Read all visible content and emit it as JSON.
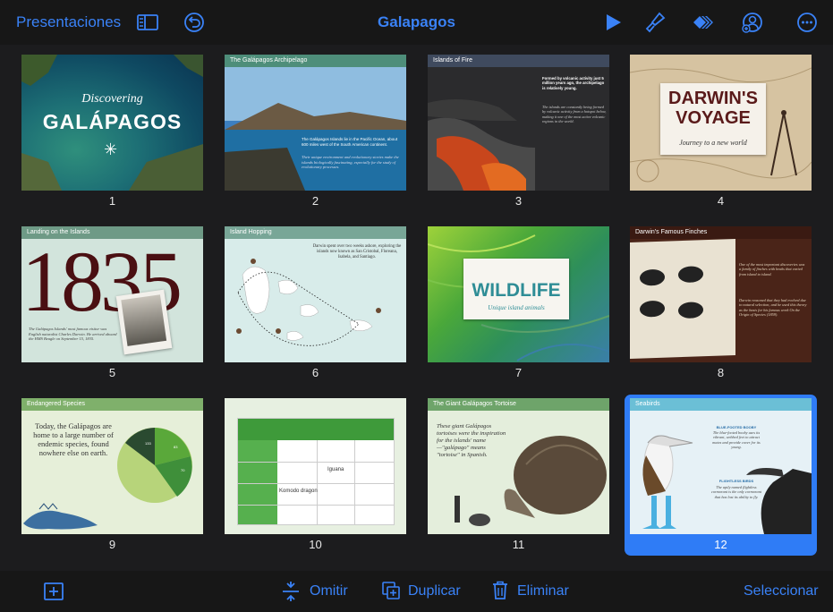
{
  "topbar": {
    "back_label": "Presentaciones",
    "title": "Galapagos"
  },
  "icons": {
    "sidebar": "sidebar-icon",
    "undo": "undo-icon",
    "play": "play-icon",
    "format": "paintbrush-icon",
    "animate": "animate-icon",
    "collaborate": "collaborate-icon",
    "more": "more-icon"
  },
  "slides": [
    {
      "number": "1",
      "title": "Discovering",
      "subtitle": "GALÁPAGOS"
    },
    {
      "number": "2",
      "title": "The Galápagos Archipelago",
      "bullet1": "The Galápagos Islands lie in the Pacific Ocean, about 600 miles west of the South American continent.",
      "bullet2": "Their unique environment and evolutionary stories make the islands biologically fascinating, especially for the study of evolutionary processes."
    },
    {
      "number": "3",
      "title": "Islands of Fire",
      "text1": "Formed by volcanic activity just 5 million years ago, the archipelago is relatively young.",
      "text2": "The islands are constantly being formed by volcanic activity from a hotspot below, making it one of the most active volcanic regions in the world."
    },
    {
      "number": "4",
      "title": "DARWIN'S VOYAGE",
      "subtitle": "Journey to a new world"
    },
    {
      "number": "5",
      "title": "Landing on the Islands",
      "year": "1835",
      "caption": "The Galápagos Islands' most famous visitor was English naturalist Charles Darwin. He arrived aboard the HMS Beagle on September 15, 1835."
    },
    {
      "number": "6",
      "title": "Island Hopping",
      "text": "Darwin spent over two weeks ashore, exploring the islands now known as San Cristobal, Floreana, Isabela, and Santiago."
    },
    {
      "number": "7",
      "title": "WILDLIFE",
      "subtitle": "Unique island animals"
    },
    {
      "number": "8",
      "title": "Darwin's Famous Finches",
      "text1": "One of the most important discoveries was a family of finches with beaks that varied from island to island.",
      "text2": "Darwin reasoned that they had evolved due to natural selection, and he used this theory as the basis for his famous work On the Origin of Species (1859)."
    },
    {
      "number": "9",
      "title": "Endangered Species",
      "text": "Today, the Galápagos are home to a large number of endemic species, found nowhere else on earth.",
      "chart_values": [
        "133",
        "83",
        "70"
      ]
    },
    {
      "number": "10",
      "table_label1": "Iguana",
      "table_label2": "Komodo dragon"
    },
    {
      "number": "11",
      "title": "The Giant Galápagos Tortoise",
      "text": "These giant Galápagos tortoises were the inspiration for the islands' name—\"galápago\" means \"tortoise\" in Spanish."
    },
    {
      "number": "12",
      "title": "Seabirds",
      "label1": "BLUE-FOOTED BOOBY",
      "text1": "The blue-footed booby uses its vibrant, webbed feet to attract mates and provide cover for its young.",
      "label2": "FLIGHTLESS BIRDS",
      "text2": "The aptly named flightless cormorant is the only cormorant that has lost its ability to fly."
    }
  ],
  "bottombar": {
    "add_icon": "add-slide-icon",
    "skip_label": "Omitir",
    "duplicate_label": "Duplicar",
    "delete_label": "Eliminar",
    "select_label": "Seleccionar"
  },
  "colors": {
    "accent": "#3a82f7",
    "selection": "#2f7cf6",
    "background": "#1c1c1e"
  }
}
